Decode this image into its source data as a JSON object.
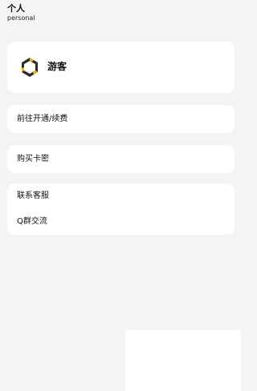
{
  "header": {
    "title": "个人",
    "subtitle": "personal"
  },
  "profile": {
    "username": "游客",
    "logo_icon": "hexagon-logo-icon"
  },
  "menu": {
    "renew_label": "前往开通/续费",
    "buy_card_label": "购买卡密",
    "contact_service_label": "联系客服",
    "q_group_label": "Q群交流"
  },
  "colors": {
    "background": "#f4f4f4",
    "card": "#ffffff",
    "logo_yellow": "#f5b800",
    "logo_dark": "#2b2b2b"
  }
}
